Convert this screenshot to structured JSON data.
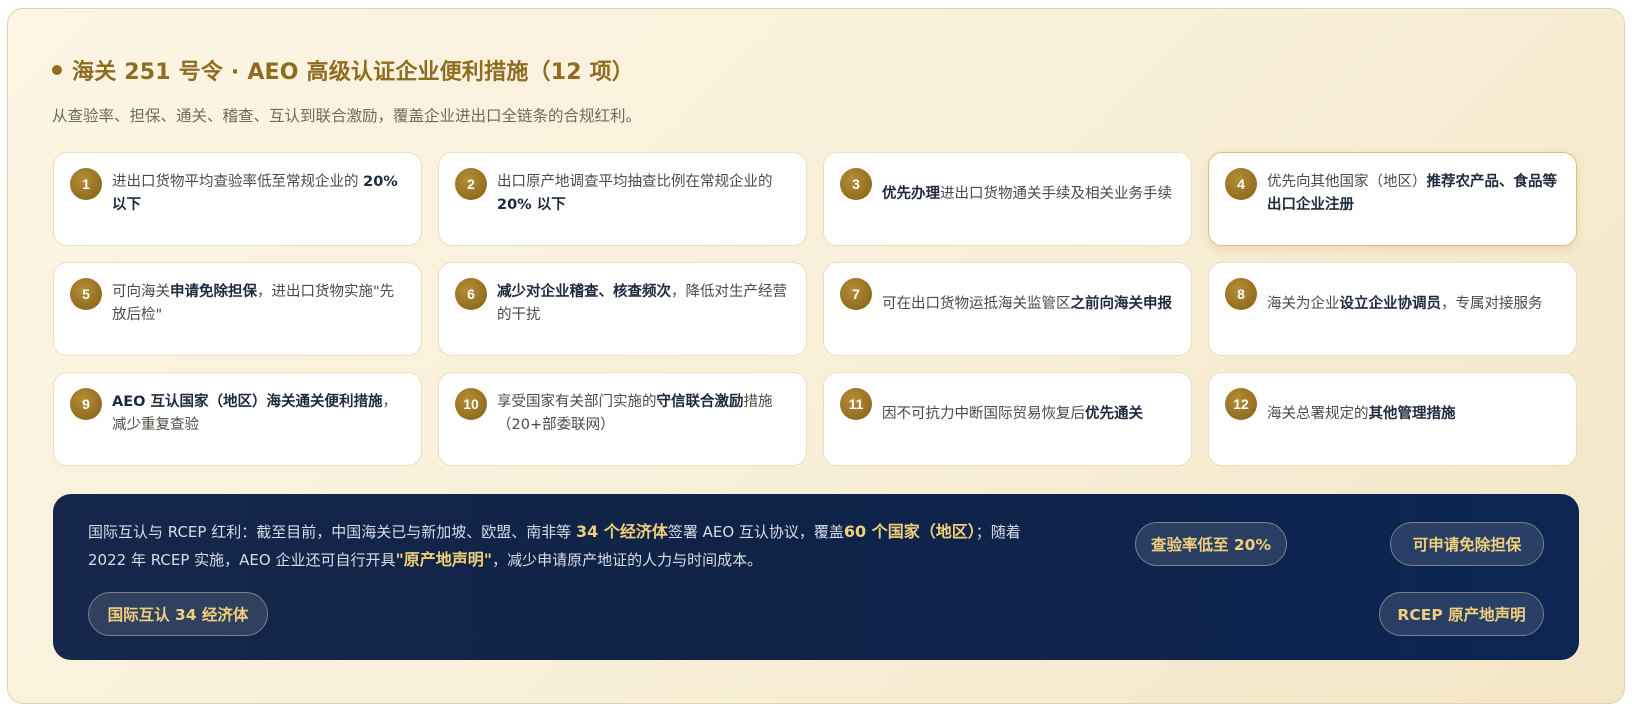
{
  "header": {
    "title": "海关 251 号令 · AEO 高级认证企业便利措施（12 项）",
    "subtitle": "从查验率、担保、通关、稽查、互认到联合激励，覆盖企业进出口全链条的合规红利。"
  },
  "colors": {
    "accent_gold": "#8f6c1f",
    "footer_navy": "#0f2347",
    "highlight_text": "#f2cf7a"
  },
  "items": [
    {
      "num": "1",
      "pre": "进出口货物平均查验率低至常规企业的 ",
      "bold": "20% 以下",
      "post": ""
    },
    {
      "num": "2",
      "pre": "出口原产地调查平均抽查比例在常规企业的 ",
      "bold": "20% 以下",
      "post": ""
    },
    {
      "num": "3",
      "pre": "",
      "bold": "优先办理",
      "post": "进出口货物通关手续及相关业务手续"
    },
    {
      "num": "4",
      "pre": "优先向其他国家（地区）",
      "bold": "推荐农产品、食品等出口企业注册",
      "post": ""
    },
    {
      "num": "5",
      "pre": "可向海关",
      "bold": "申请免除担保",
      "post": "，进出口货物实施\"先放后检\""
    },
    {
      "num": "6",
      "pre": "",
      "bold": "减少对企业稽查、核查频次",
      "post": "，降低对生产经营的干扰"
    },
    {
      "num": "7",
      "pre": "可在出口货物运抵海关监管区",
      "bold": "之前向海关申报",
      "post": ""
    },
    {
      "num": "8",
      "pre": "海关为企业",
      "bold": "设立企业协调员",
      "post": "，专属对接服务"
    },
    {
      "num": "9",
      "pre": "",
      "bold": "AEO 互认国家（地区）海关通关便利措施",
      "post": "，减少重复查验"
    },
    {
      "num": "10",
      "pre": "享受国家有关部门实施的",
      "bold": "守信联合激励",
      "post": "措施（20+部委联网）"
    },
    {
      "num": "11",
      "pre": "因不可抗力中断国际贸易恢复后",
      "bold": "优先通关",
      "post": ""
    },
    {
      "num": "12",
      "pre": "海关总署规定的",
      "bold": "其他管理措施",
      "post": ""
    }
  ],
  "footer": {
    "p1": "国际互认与 RCEP 红利：截至目前，中国海关已与新加坡、欧盟、南非等 ",
    "h1": "34 个经济体",
    "p2": "签署 AEO 互认协议，覆盖",
    "h2": "60 个国家（地区）",
    "p3": "；随着 2022 年 RCEP 实施，AEO 企业还可自行开具",
    "h3": "\"原产地声明\"",
    "p4": "，减少申请原产地证的人力与时间成本。",
    "tags": {
      "inspection": "查验率低至 20%",
      "guarantee": "可申请免除担保",
      "mutual": "国际互认 34 经济体",
      "rcep": "RCEP 原产地声明"
    }
  }
}
